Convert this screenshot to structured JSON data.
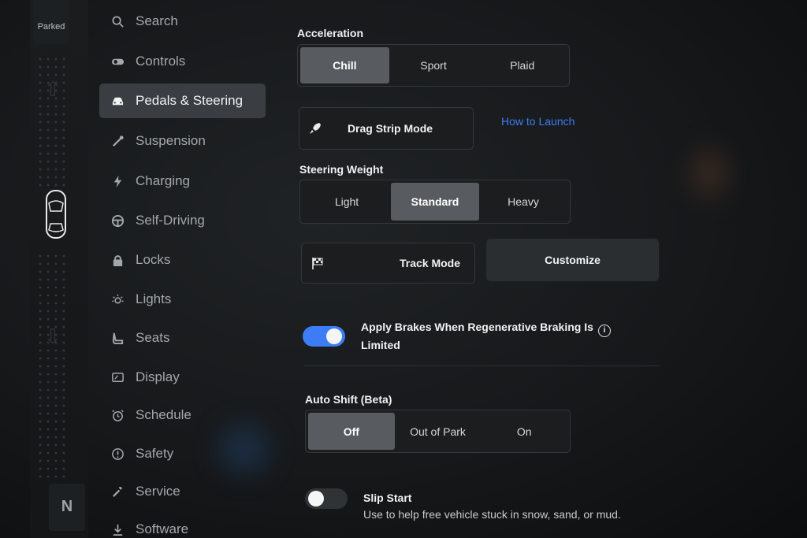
{
  "gear": {
    "parked_label": "Parked",
    "neutral_label": "N"
  },
  "sidebar": {
    "items": [
      {
        "label": "Search",
        "icon": "search-icon"
      },
      {
        "label": "Controls",
        "icon": "toggle-icon"
      },
      {
        "label": "Pedals & Steering",
        "icon": "car-icon",
        "active": true
      },
      {
        "label": "Suspension",
        "icon": "wrench-icon"
      },
      {
        "label": "Charging",
        "icon": "lightning-icon"
      },
      {
        "label": "Self-Driving",
        "icon": "steering-wheel-icon"
      },
      {
        "label": "Locks",
        "icon": "lock-icon"
      },
      {
        "label": "Lights",
        "icon": "sun-icon"
      },
      {
        "label": "Seats",
        "icon": "seat-icon"
      },
      {
        "label": "Display",
        "icon": "display-icon"
      },
      {
        "label": "Schedule",
        "icon": "alarm-clock-icon"
      },
      {
        "label": "Safety",
        "icon": "alert-circle-icon"
      },
      {
        "label": "Service",
        "icon": "wrench-icon"
      },
      {
        "label": "Software",
        "icon": "download-icon"
      }
    ]
  },
  "acceleration": {
    "label": "Acceleration",
    "options": [
      "Chill",
      "Sport",
      "Plaid"
    ],
    "selected": "Chill"
  },
  "drag_strip": {
    "label": "Drag Strip Mode",
    "link": "How to Launch"
  },
  "steering_weight": {
    "label": "Steering Weight",
    "options": [
      "Light",
      "Standard",
      "Heavy"
    ],
    "selected": "Standard"
  },
  "track_mode": {
    "label": "Track Mode",
    "customize": "Customize"
  },
  "regen_brakes": {
    "label_line1": "Apply Brakes When Regenerative Braking Is",
    "label_line2": "Limited",
    "enabled": true
  },
  "auto_shift": {
    "label": "Auto Shift (Beta)",
    "options": [
      "Off",
      "Out of Park",
      "On"
    ],
    "selected": "Off"
  },
  "slip_start": {
    "label": "Slip Start",
    "description": "Use to help free vehicle stuck in snow, sand, or mud.",
    "enabled": false
  },
  "colors": {
    "accent": "#3e7cf5",
    "selected_segment": "#585c60",
    "panel": "#1b1d1f"
  }
}
